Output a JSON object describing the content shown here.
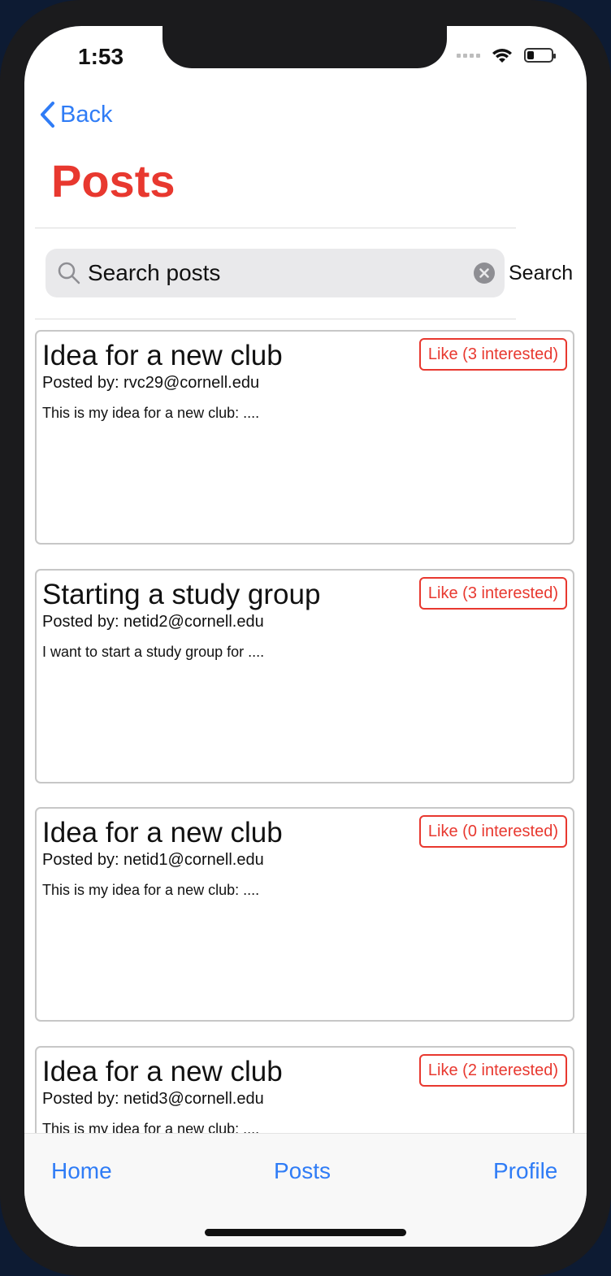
{
  "status_bar": {
    "time": "1:53"
  },
  "nav": {
    "back_label": "Back",
    "title": "Posts"
  },
  "search": {
    "placeholder": "Search posts",
    "button_label": "Search"
  },
  "posts": [
    {
      "title": "Idea for a new club",
      "author": "Posted by: rvc29@cornell.edu",
      "body": "This is my idea for a new club: ....",
      "like_label": "Like (3 interested)"
    },
    {
      "title": "Starting a study group",
      "author": "Posted by: netid2@cornell.edu",
      "body": "I want to start a study group for ....",
      "like_label": "Like (3 interested)"
    },
    {
      "title": "Idea for a new club",
      "author": "Posted by: netid1@cornell.edu",
      "body": "This is my idea for a new club: ....",
      "like_label": "Like (0 interested)"
    },
    {
      "title": "Idea for a new club",
      "author": "Posted by: netid3@cornell.edu",
      "body": "This is my idea for a new club: ....",
      "like_label": "Like (2 interested)"
    }
  ],
  "tabbar": {
    "home": "Home",
    "posts": "Posts",
    "profile": "Profile"
  },
  "colors": {
    "accent_red": "#e8382f",
    "link_blue": "#2f7cf6"
  }
}
